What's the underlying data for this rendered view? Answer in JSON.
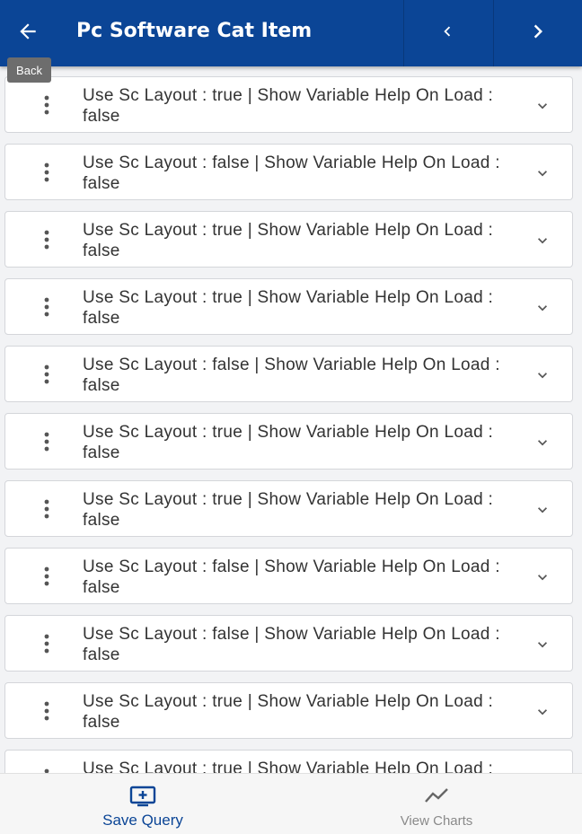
{
  "header": {
    "title": "Pc Software Cat Item",
    "back_tooltip": "Back"
  },
  "items": [
    {
      "text": "Use Sc Layout : true | Show Variable Help On Load : false"
    },
    {
      "text": "Use Sc Layout : false | Show Variable Help On Load : false"
    },
    {
      "text": "Use Sc Layout : true | Show Variable Help On Load : false"
    },
    {
      "text": "Use Sc Layout : true | Show Variable Help On Load : false"
    },
    {
      "text": "Use Sc Layout : false | Show Variable Help On Load : false"
    },
    {
      "text": "Use Sc Layout : true | Show Variable Help On Load : false"
    },
    {
      "text": "Use Sc Layout : true | Show Variable Help On Load : false"
    },
    {
      "text": "Use Sc Layout : false | Show Variable Help On Load : false"
    },
    {
      "text": "Use Sc Layout : false | Show Variable Help On Load : false"
    },
    {
      "text": "Use Sc Layout : true | Show Variable Help On Load : false"
    },
    {
      "text": "Use Sc Layout : true | Show Variable Help On Load : false"
    }
  ],
  "bottom_nav": {
    "save_query": "Save Query",
    "view_charts": "View Charts"
  },
  "colors": {
    "header_bg": "#0b4596",
    "active_tab": "#0b4596",
    "inactive_tab": "#8a8a8a"
  },
  "icons": {
    "back": "arrow-left-icon",
    "prev": "chevron-left-icon",
    "next": "chevron-right-icon",
    "item_menu": "more-vertical-icon",
    "item_expand": "chevron-down-icon",
    "save_query": "add-to-screen-icon",
    "view_charts": "line-chart-icon"
  }
}
